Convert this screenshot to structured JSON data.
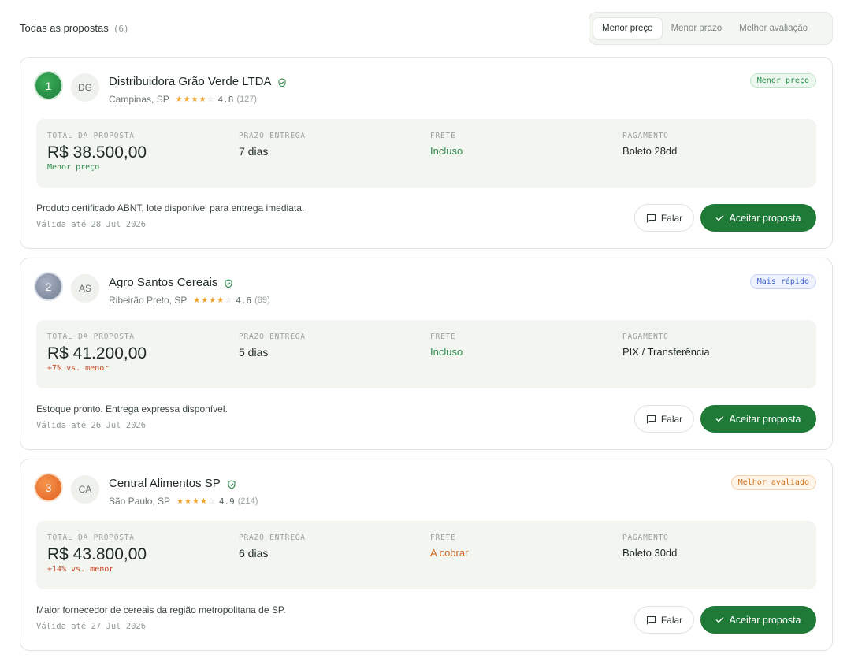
{
  "header": {
    "title": "Todas as propostas",
    "count": "(6)",
    "sort_options": [
      {
        "label": "Menor preço",
        "active": true
      },
      {
        "label": "Menor prazo",
        "active": false
      },
      {
        "label": "Melhor avaliação",
        "active": false
      }
    ]
  },
  "labels": {
    "total": "TOTAL DA PROPOSTA",
    "delivery": "PRAZO ENTREGA",
    "freight": "FRETE",
    "payment": "PAGAMENTO",
    "talk_button": "Falar",
    "accept_button": "Aceitar proposta"
  },
  "proposals": [
    {
      "rank": "1",
      "initials": "DG",
      "name": "Distribuidora Grão Verde LTDA",
      "location": "Campinas, SP",
      "stars": "★★★★",
      "stars_empty": "☆",
      "rating": "4.8",
      "reviews": "(127)",
      "badge": "Menor preço",
      "total": "R$ 38.500,00",
      "total_note": "Menor preço",
      "delivery": "7 dias",
      "freight": "Incluso",
      "payment": "Boleto 28dd",
      "note": "Produto certificado ABNT, lote disponível para entrega imediata.",
      "valid": "Válida até 28 Jul 2026"
    },
    {
      "rank": "2",
      "initials": "AS",
      "name": "Agro Santos Cereais",
      "location": "Ribeirão Preto, SP",
      "stars": "★★★★",
      "stars_empty": "☆",
      "rating": "4.6",
      "reviews": "(89)",
      "badge": "Mais rápido",
      "total": "R$ 41.200,00",
      "total_note": "+7% vs. menor",
      "delivery": "5 dias",
      "freight": "Incluso",
      "payment": "PIX / Transferência",
      "note": "Estoque pronto. Entrega expressa disponível.",
      "valid": "Válida até 26 Jul 2026"
    },
    {
      "rank": "3",
      "initials": "CA",
      "name": "Central Alimentos SP",
      "location": "São Paulo, SP",
      "stars": "★★★★",
      "stars_empty": "☆",
      "rating": "4.9",
      "reviews": "(214)",
      "badge": "Melhor avaliado",
      "total": "R$ 43.800,00",
      "total_note": "+14% vs. menor",
      "delivery": "6 dias",
      "freight": "A cobrar",
      "payment": "Boleto 30dd",
      "note": "Maior fornecedor de cereais da região metropolitana de SP.",
      "valid": "Válida até 27 Jul 2026"
    }
  ],
  "colors": {
    "accent_green": "#1f7a38",
    "freight_included": "#2f8a4d",
    "freight_charged": "#d2681e",
    "price_increase": "#c64a2a"
  },
  "icons": {
    "verified": "shield-check-icon",
    "talk": "chat-bubble-icon",
    "accept": "check-icon"
  }
}
